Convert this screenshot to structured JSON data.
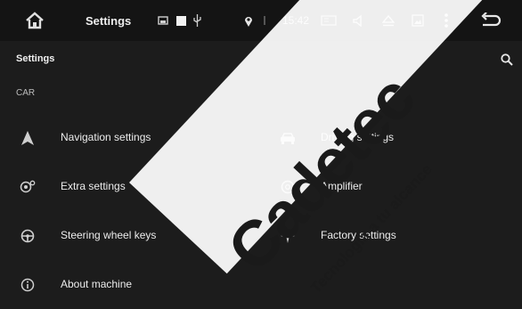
{
  "status_bar": {
    "icons": [
      "home-icon",
      "sd-card-icon",
      "square-icon",
      "usb-icon",
      "location-icon",
      "radio-icon",
      "volume-icon",
      "eject-icon",
      "screenshot-icon",
      "menu-dots-icon",
      "back-icon"
    ],
    "title": "Settings",
    "time": "15:42"
  },
  "app_bar": {
    "title": "Settings",
    "search_icon": "search-icon"
  },
  "section": {
    "header": "CAR"
  },
  "settings_items": [
    {
      "label": "Navigation settings",
      "icon": "navigation-icon"
    },
    {
      "label": "Driving settings",
      "icon": "car-icon"
    },
    {
      "label": "Extra settings",
      "icon": "extra-settings-icon"
    },
    {
      "label": "Amplifier",
      "icon": "amplifier-icon"
    },
    {
      "label": "Steering wheel keys",
      "icon": "steering-wheel-icon"
    },
    {
      "label": "Factory settings",
      "icon": "factory-icon"
    },
    {
      "label": "About machine",
      "icon": "info-icon"
    }
  ],
  "watermark": {
    "brand": "Cadetec",
    "slogan": "Tecnología a tu alcance"
  },
  "colors": {
    "background": "#1c1c1c",
    "status_bar": "#141414",
    "text": "#ececec",
    "secondary_text": "#bcbcbc"
  }
}
